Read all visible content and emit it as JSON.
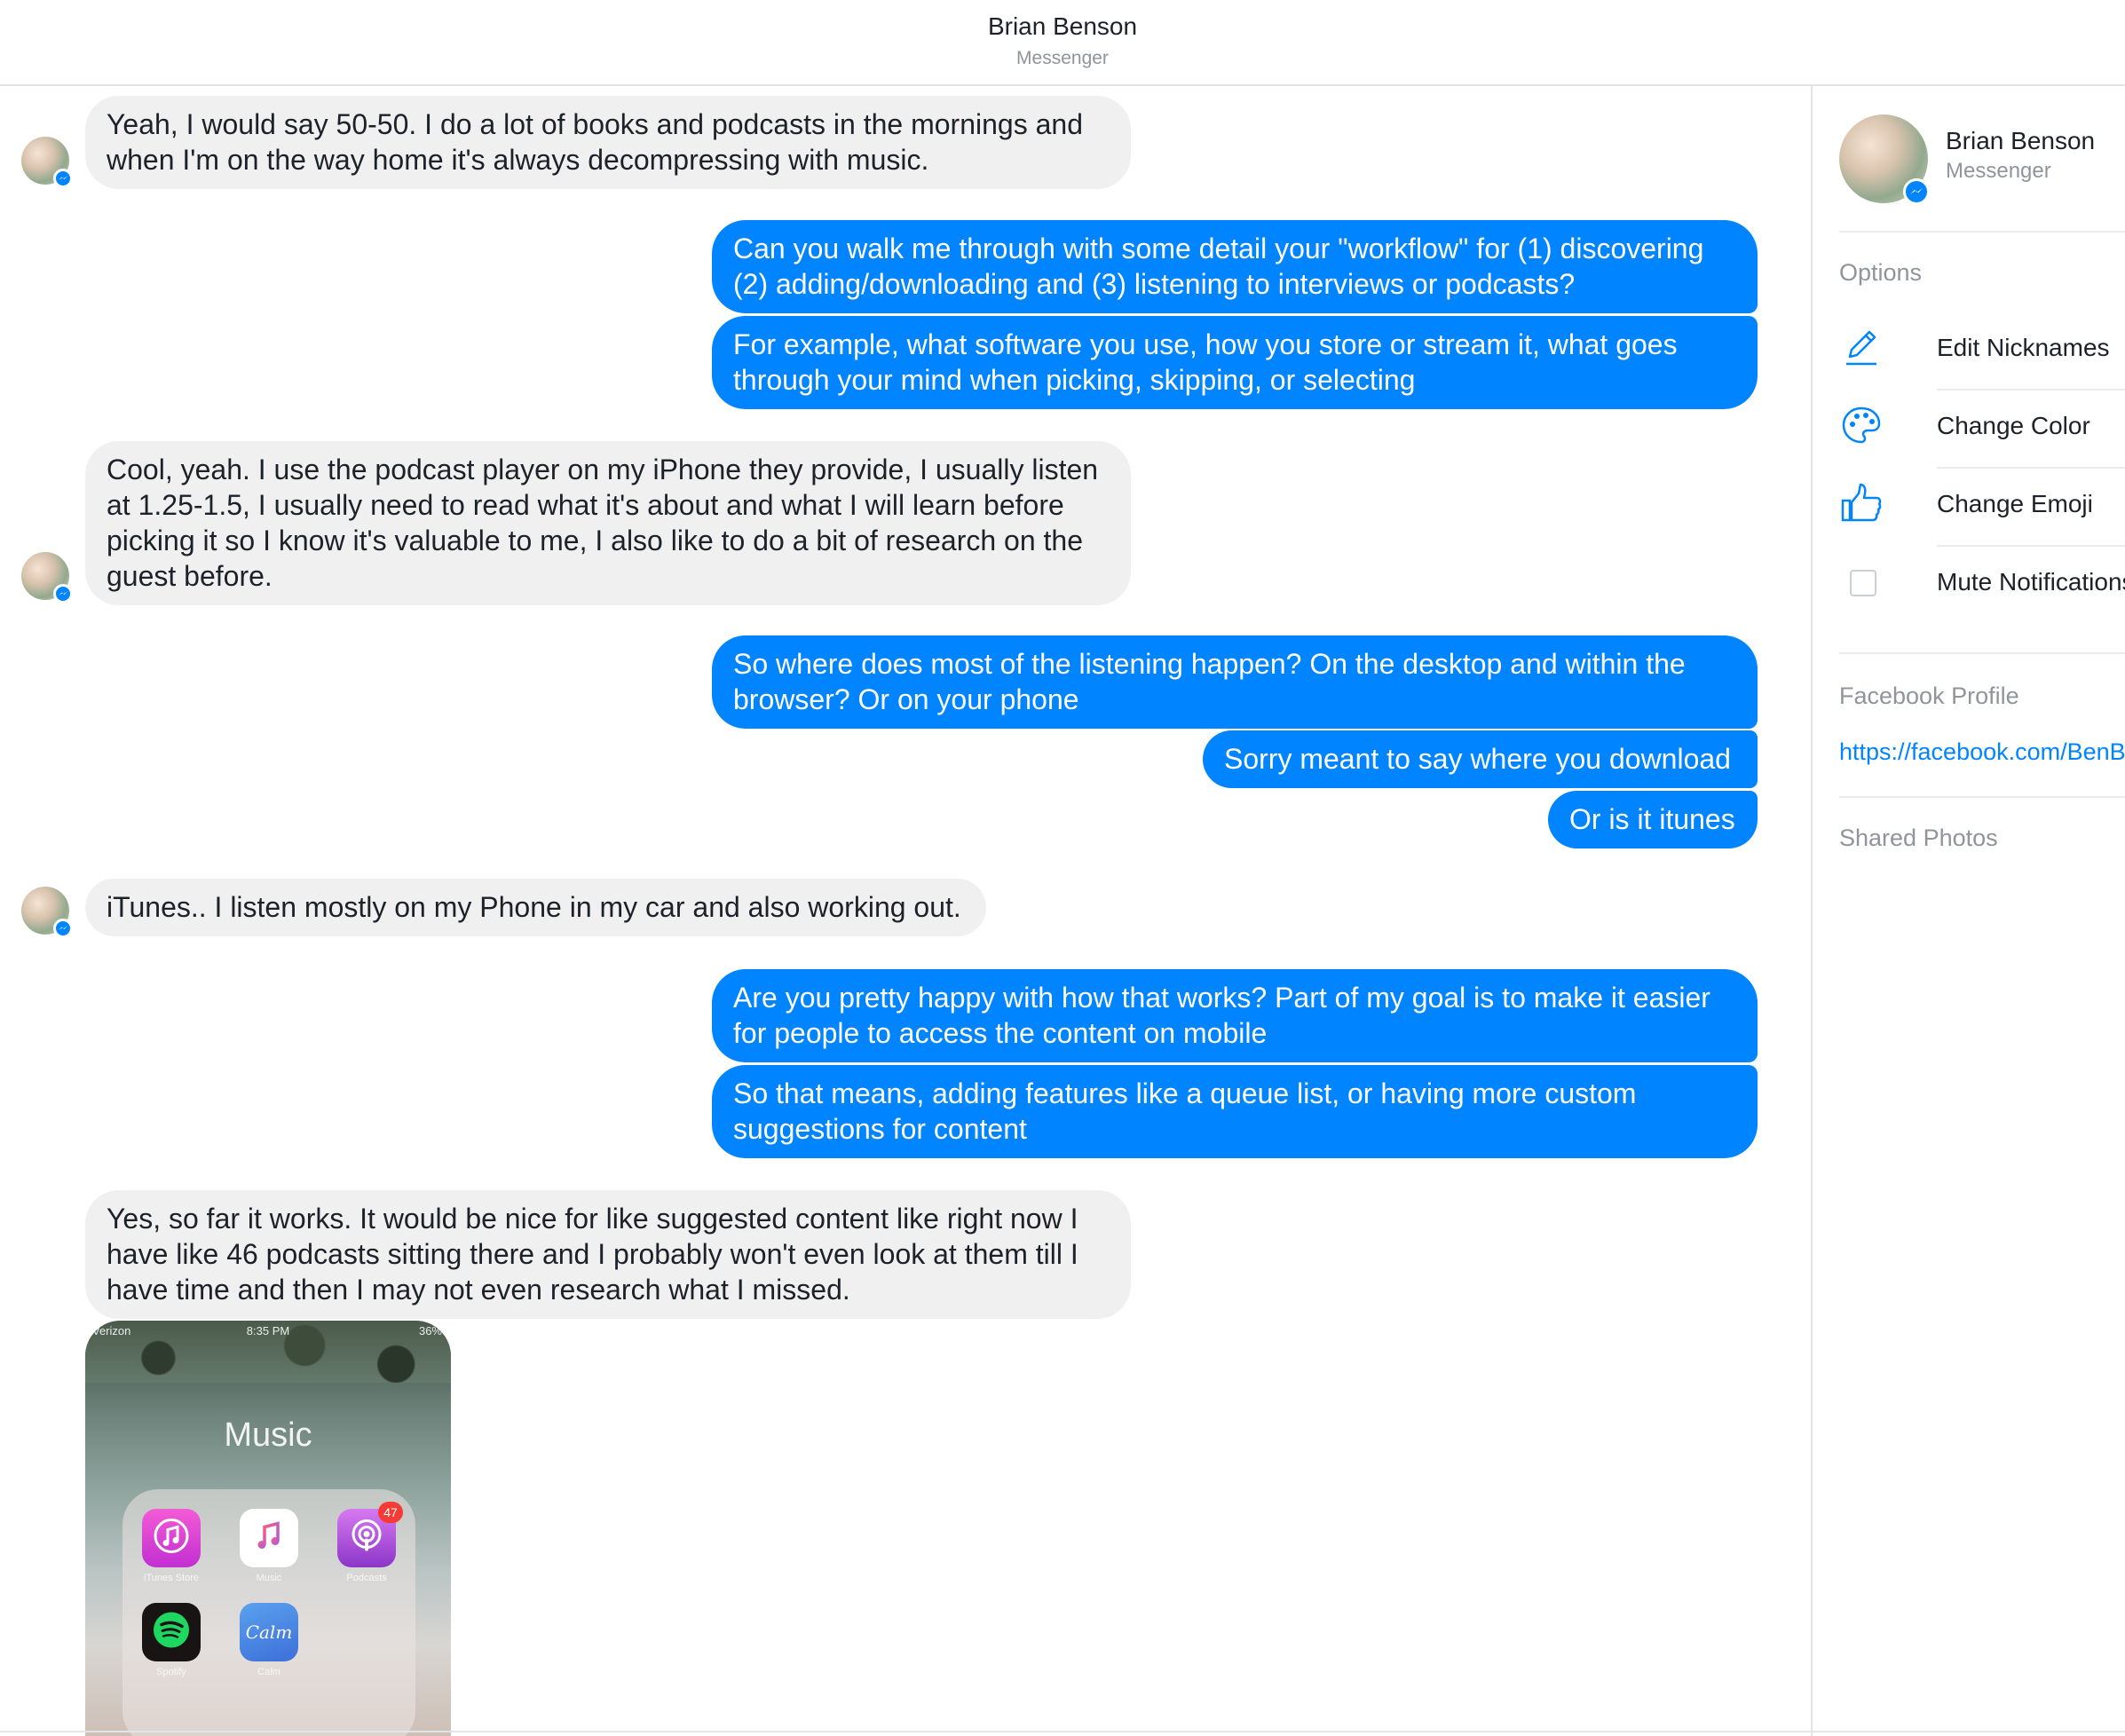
{
  "header": {
    "title": "Brian Benson",
    "subtitle": "Messenger"
  },
  "messages": [
    {
      "from": "them",
      "text": "Yeah, I would say 50-50. I do a lot of books and podcasts in the mornings and when I'm on the way home it's always decompressing with music."
    },
    {
      "from": "me",
      "text": "Can you walk me through with some detail your \"workflow\" for (1) discovering (2) adding/downloading and (3) listening to interviews or podcasts?"
    },
    {
      "from": "me",
      "text": "For example, what software you use, how you store or stream it, what goes through your mind when picking, skipping, or selecting"
    },
    {
      "from": "them",
      "text": "Cool, yeah. I use the podcast player on my iPhone they provide, I usually listen at 1.25-1.5, I usually need to read what it's about and what I will learn before picking it so I know it's valuable to me, I also like to do a bit of research on the guest before."
    },
    {
      "from": "me",
      "text": "So where does most of the listening happen? On the desktop and within the browser? Or on your phone"
    },
    {
      "from": "me",
      "text": "Sorry meant to say where you download"
    },
    {
      "from": "me",
      "text": "Or is it itunes"
    },
    {
      "from": "them",
      "text": "iTunes.. I listen mostly on my Phone in my car and also working out."
    },
    {
      "from": "me",
      "text": "Are you pretty happy with how that works? Part of my goal is to make it easier for people to access the content on mobile"
    },
    {
      "from": "me",
      "text": "So that means, adding features like a queue list, or having more custom suggestions for content"
    },
    {
      "from": "them",
      "text": "Yes, so far it works. It would be nice for like suggested content like right now I have like 46 podcasts sitting there and I probably won't even look at them till I have time and then I may not even research what I missed."
    }
  ],
  "photo": {
    "status_carrier": "Verizon",
    "status_time": "8:35 PM",
    "status_battery": "36%",
    "folder_name": "Music",
    "apps": [
      {
        "label": "iTunes Store",
        "icon": "itunes-store-icon"
      },
      {
        "label": "Music",
        "icon": "music-app-icon"
      },
      {
        "label": "Podcasts",
        "icon": "podcasts-app-icon",
        "badge": "47"
      },
      {
        "label": "Spotify",
        "icon": "spotify-app-icon"
      },
      {
        "label": "Calm",
        "icon": "calm-app-icon",
        "glyph": "Calm"
      }
    ]
  },
  "sidebar": {
    "name": "Brian Benson",
    "subtitle": "Messenger",
    "options_heading": "Options",
    "options": [
      {
        "label": "Edit Nicknames",
        "icon": "pencil-icon"
      },
      {
        "label": "Change Color",
        "icon": "palette-icon"
      },
      {
        "label": "Change Emoji",
        "icon": "thumbs-up-icon"
      },
      {
        "label": "Mute Notifications",
        "icon": "checkbox-icon"
      }
    ],
    "profile_heading": "Facebook Profile",
    "profile_link": "https://facebook.com/BenB",
    "photos_heading": "Shared Photos"
  },
  "colors": {
    "accent": "#0084ff",
    "incoming_bubble": "#f1f0f0",
    "secondary_text": "#90949c"
  }
}
